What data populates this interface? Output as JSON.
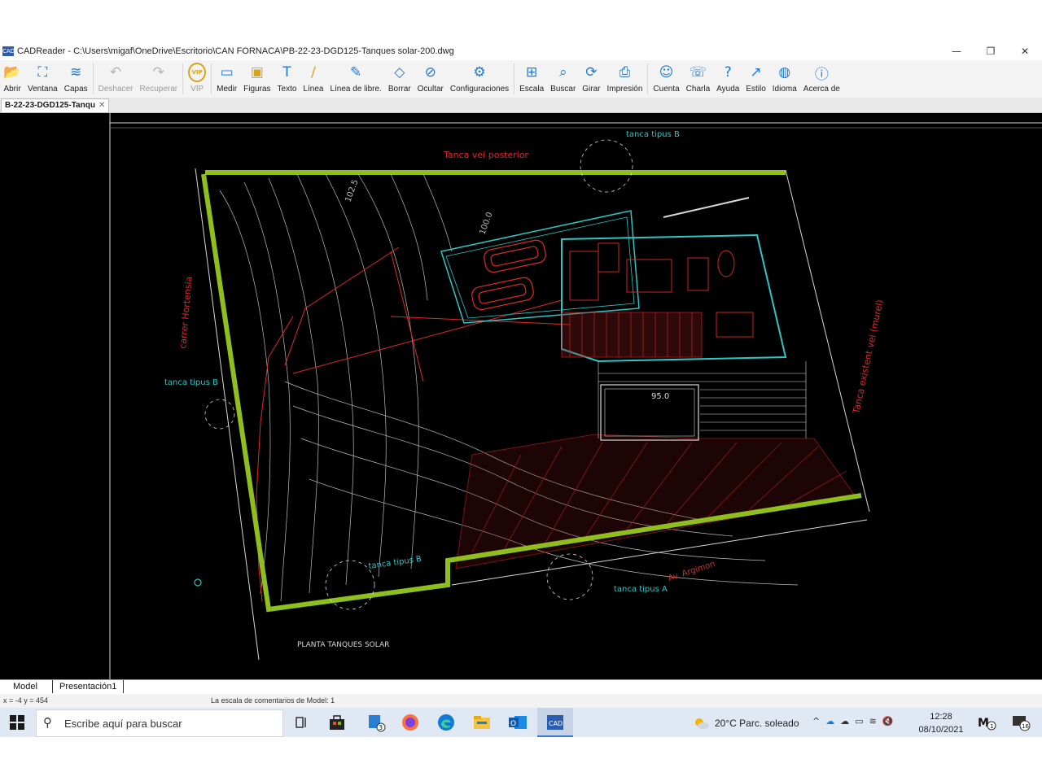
{
  "window": {
    "title": "CADReader - C:\\Users\\migaf\\OneDrive\\Escritorio\\CAN FORNACA\\PB-22-23-DGD125-Tanques solar-200.dwg",
    "app_icon_text": "CAD",
    "controls": {
      "minimize": "—",
      "restore": "❐",
      "close": "✕"
    }
  },
  "toolbar": {
    "items": [
      {
        "label": "Abrir",
        "icon": "folder-open-icon",
        "color": "#1e7ad6",
        "enabled": true
      },
      {
        "label": "Ventana",
        "icon": "window-zoom-icon",
        "color": "#1e7ad6",
        "enabled": true
      },
      {
        "label": "Capas",
        "icon": "layers-icon",
        "color": "#1e7ad6",
        "enabled": true
      },
      {
        "label": "Deshacer",
        "icon": "undo-icon",
        "color": "#b5b5b5",
        "enabled": false
      },
      {
        "label": "Recuperar",
        "icon": "redo-icon",
        "color": "#b5b5b5",
        "enabled": false
      },
      {
        "label": "VIP",
        "icon": "vip-badge-icon",
        "color": "#d9a21b",
        "enabled": false
      },
      {
        "label": "Medir",
        "icon": "measure-icon",
        "color": "#1e7ad6",
        "enabled": true
      },
      {
        "label": "Figuras",
        "icon": "shapes-icon",
        "color": "#d9a21b",
        "enabled": true
      },
      {
        "label": "Texto",
        "icon": "text-icon",
        "color": "#1e7ad6",
        "enabled": true
      },
      {
        "label": "Línea",
        "icon": "line-icon",
        "color": "#d9a21b",
        "enabled": true
      },
      {
        "label": "Línea de libre.",
        "icon": "freehand-pen-icon",
        "color": "#1e7ad6",
        "enabled": true
      },
      {
        "label": "Borrar",
        "icon": "eraser-icon",
        "color": "#1e7ad6",
        "enabled": true
      },
      {
        "label": "Ocultar",
        "icon": "hide-eye-icon",
        "color": "#1e7ad6",
        "enabled": true
      },
      {
        "label": "Configuraciones",
        "icon": "settings-icon",
        "color": "#1e7ad6",
        "enabled": true
      },
      {
        "label": "Escala",
        "icon": "scale-icon",
        "color": "#1e7ad6",
        "enabled": true
      },
      {
        "label": "Buscar",
        "icon": "search-icon",
        "color": "#1e7ad6",
        "enabled": true
      },
      {
        "label": "Girar",
        "icon": "rotate-icon",
        "color": "#1e7ad6",
        "enabled": true
      },
      {
        "label": "Impresión",
        "icon": "printer-icon",
        "color": "#1e7ad6",
        "enabled": true
      },
      {
        "label": "Cuenta",
        "icon": "user-icon",
        "color": "#1e7ad6",
        "enabled": true
      },
      {
        "label": "Charla",
        "icon": "chat-icon",
        "color": "#1e7ad6",
        "enabled": true
      },
      {
        "label": "Ayuda",
        "icon": "help-icon",
        "color": "#1e7ad6",
        "enabled": true
      },
      {
        "label": "Estilo",
        "icon": "style-icon",
        "color": "#1e7ad6",
        "enabled": true
      },
      {
        "label": "Idioma",
        "icon": "globe-icon",
        "color": "#1e7ad6",
        "enabled": true
      },
      {
        "label": "Acerca de",
        "icon": "info-icon",
        "color": "#1e7ad6",
        "enabled": true
      }
    ]
  },
  "document_tab": {
    "label": "B-22-23-DGD125-Tanqu",
    "close": "✕"
  },
  "drawing": {
    "labels": {
      "tanco_vei_posterior": "Tanca vei posterior",
      "tanca_tipus_b_top": "tanca tipus B",
      "tanca_tipus_b_left": "tanca tipus B",
      "tanca_tipus_b_bottom": "tanca tipus B",
      "tanca_tipus_a": "tanca tipus A",
      "carrer_hortensia": "carrer Hortensia",
      "tanca_existent": "Tanca existent vei (murel)",
      "av_argimon": "Av. Argimon",
      "planta_title": "PLANTA TANQUES SOLAR",
      "pool_level": "95.0",
      "level_100": "100.0",
      "level_1025": "102.5"
    },
    "colors": {
      "background": "#000000",
      "boundary": "#8fbf1f",
      "red": "#e02a2a",
      "cyan": "#2fc6c6",
      "white": "#d8d8d8",
      "blue": "#3b4bdc"
    }
  },
  "layout_tabs": {
    "model": "Model",
    "presentation": "Presentación1"
  },
  "status": {
    "coords": "x = -4 y = 454",
    "message": "La escala de comentarios de Model: 1"
  },
  "taskbar": {
    "search_placeholder": "Escribe aquí para buscar",
    "weather": "20°C  Parc. soleado",
    "time": "12:28",
    "date": "08/10/2021",
    "files_badge": "3",
    "notifications_badge": "16",
    "account_badge": "1"
  }
}
